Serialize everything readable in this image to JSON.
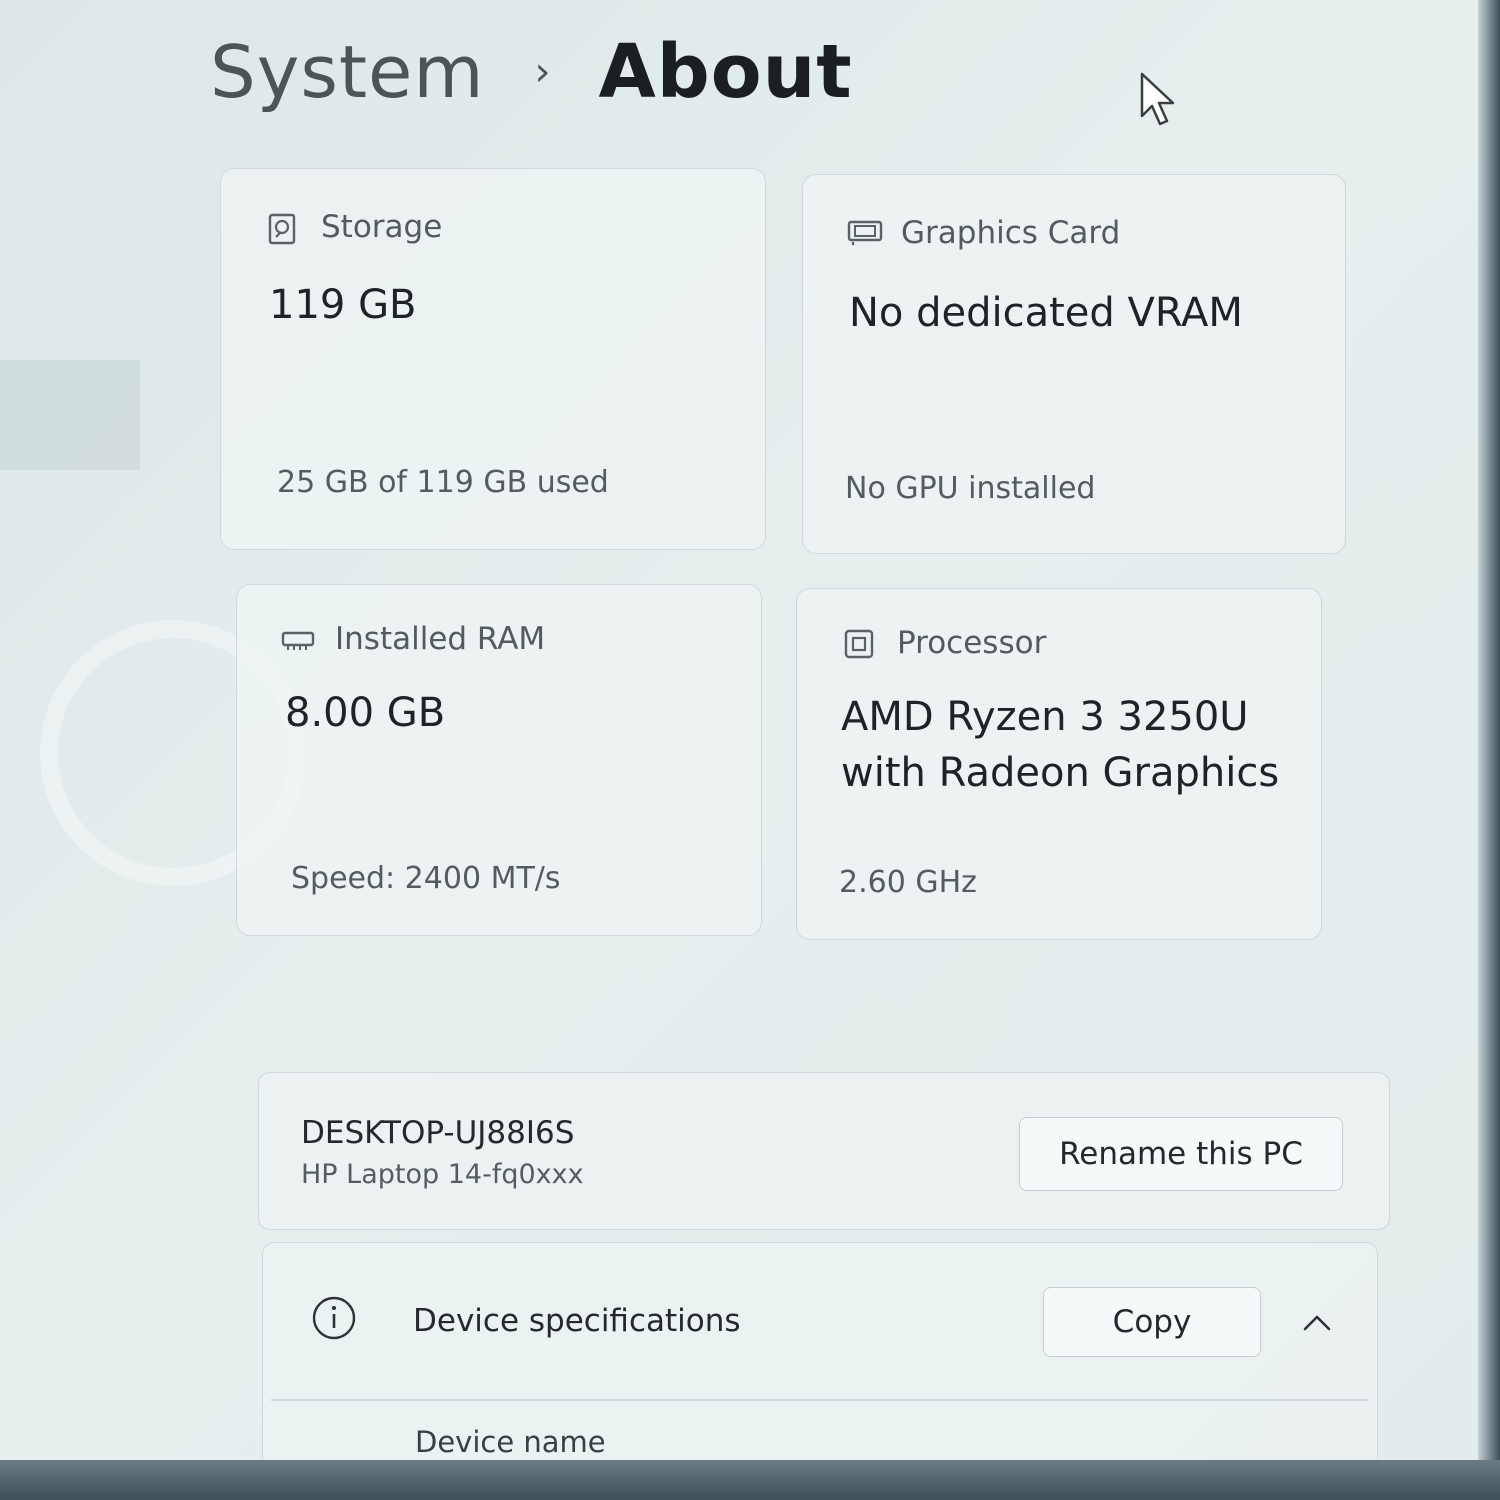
{
  "breadcrumb": {
    "parent": "System",
    "separator": "›",
    "current": "About"
  },
  "cards": {
    "storage": {
      "icon": "hard-drive-icon",
      "label": "Storage",
      "value": "119 GB",
      "sub": "25 GB of 119 GB used"
    },
    "graphics": {
      "icon": "graphics-card-icon",
      "label": "Graphics Card",
      "value": "No dedicated VRAM",
      "sub": "No GPU installed"
    },
    "ram": {
      "icon": "memory-icon",
      "label": "Installed RAM",
      "value": "8.00 GB",
      "sub": "Speed: 2400 MT/s"
    },
    "processor": {
      "icon": "processor-icon",
      "label": "Processor",
      "value_line1": "AMD Ryzen 3 3250U",
      "value_line2": "with Radeon Graphics",
      "sub": "2.60 GHz"
    }
  },
  "device": {
    "name": "DESKTOP-UJ88I6S",
    "model": "HP Laptop 14-fq0xxx",
    "rename_label": "Rename this PC"
  },
  "specs": {
    "title": "Device specifications",
    "copy_label": "Copy",
    "rows": [
      {
        "label": "Device name"
      }
    ]
  }
}
